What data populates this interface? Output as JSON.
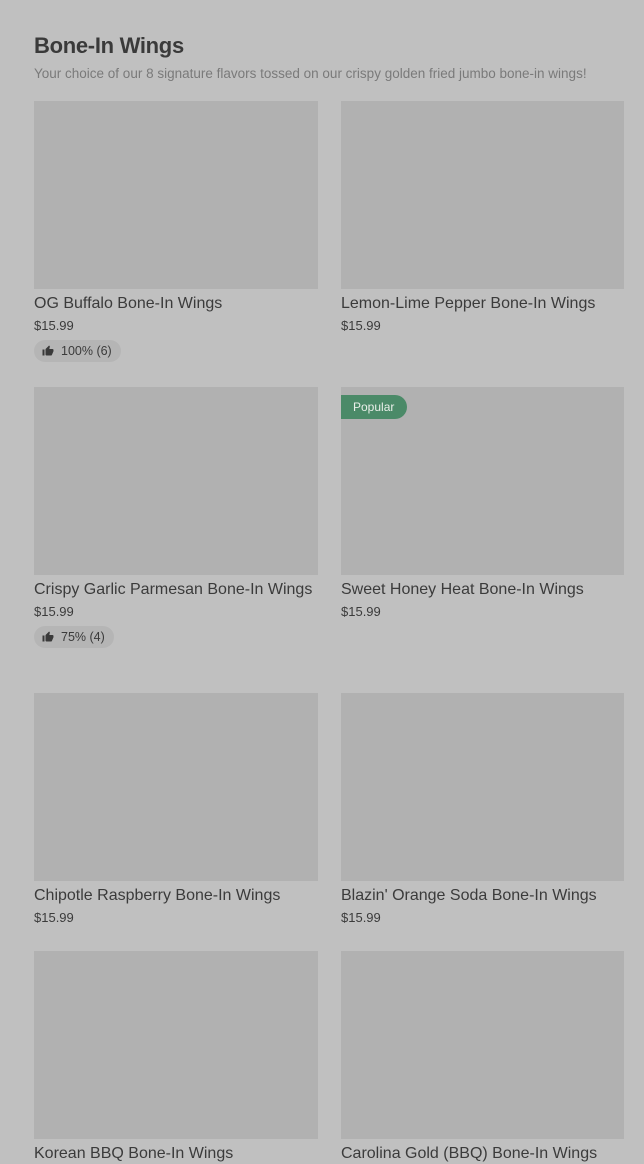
{
  "section": {
    "title": "Bone-In Wings",
    "subtitle": "Your choice of our 8 signature flavors tossed on our crispy golden fried jumbo bone-in wings!"
  },
  "items": [
    {
      "name": "OG Buffalo Bone-In Wings",
      "price": "$15.99",
      "rating": "100% (6)"
    },
    {
      "name": "Lemon-Lime Pepper Bone-In Wings",
      "price": "$15.99"
    },
    {
      "name": "Crispy Garlic Parmesan Bone-In Wings",
      "price": "$15.99",
      "rating": "75% (4)"
    },
    {
      "name": "Sweet Honey Heat Bone-In Wings",
      "price": "$15.99",
      "badge": "Popular"
    },
    {
      "name": "Chipotle Raspberry Bone-In Wings",
      "price": "$15.99"
    },
    {
      "name": "Blazin' Orange Soda Bone-In Wings",
      "price": "$15.99"
    },
    {
      "name": "Korean BBQ Bone-In Wings"
    },
    {
      "name": "Carolina Gold (BBQ) Bone-In Wings"
    }
  ],
  "icons": {
    "rating": "thumbs-up-icon"
  },
  "colors": {
    "background": "#c0c0c0",
    "image_placeholder": "#b1b1b1",
    "popular_badge": "#4b8a68"
  }
}
